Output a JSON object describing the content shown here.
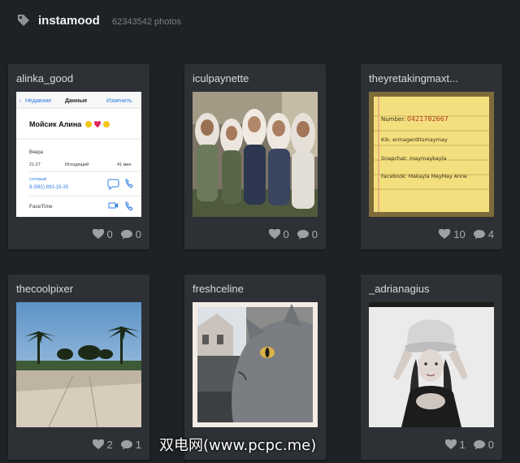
{
  "header": {
    "brand": "instamood",
    "photo_count": "62343542 photos"
  },
  "cards": [
    {
      "user": "alinka_good",
      "likes": "0",
      "comments": "0",
      "photo_text": {
        "back": "Недавние",
        "title": "Данные",
        "edit": "Изменить",
        "name": "Мойсик Алина",
        "day": "Вчера",
        "time": "21:27",
        "call_type": "Исходящий",
        "duration": "41 мин",
        "label": "сотовый",
        "number": "8 (981) 893-15-35",
        "facetime": "FaceTime"
      }
    },
    {
      "user": "iculpaynette",
      "likes": "0",
      "comments": "0"
    },
    {
      "user": "theyretakingmaxt...",
      "likes": "10",
      "comments": "4",
      "photo_text": {
        "line1_label": "Number:",
        "line1_value": "0421782667",
        "line2": "Kik: ermagerditsmaymay",
        "line3": "Snapchat: maymaykayla",
        "line4": "Facebook: Makayla MayMay Anne"
      }
    },
    {
      "user": "thecoolpixer",
      "likes": "2",
      "comments": "1"
    },
    {
      "user": "freshceline",
      "likes": "",
      "comments": ""
    },
    {
      "user": "_adrianagius",
      "likes": "1",
      "comments": "0"
    }
  ],
  "watermark": "双电网(www.pcpc.me)",
  "colors": {
    "background": "#1f2225",
    "card": "#2d3135",
    "text": "#d9dcde",
    "muted": "#a9adb1"
  }
}
